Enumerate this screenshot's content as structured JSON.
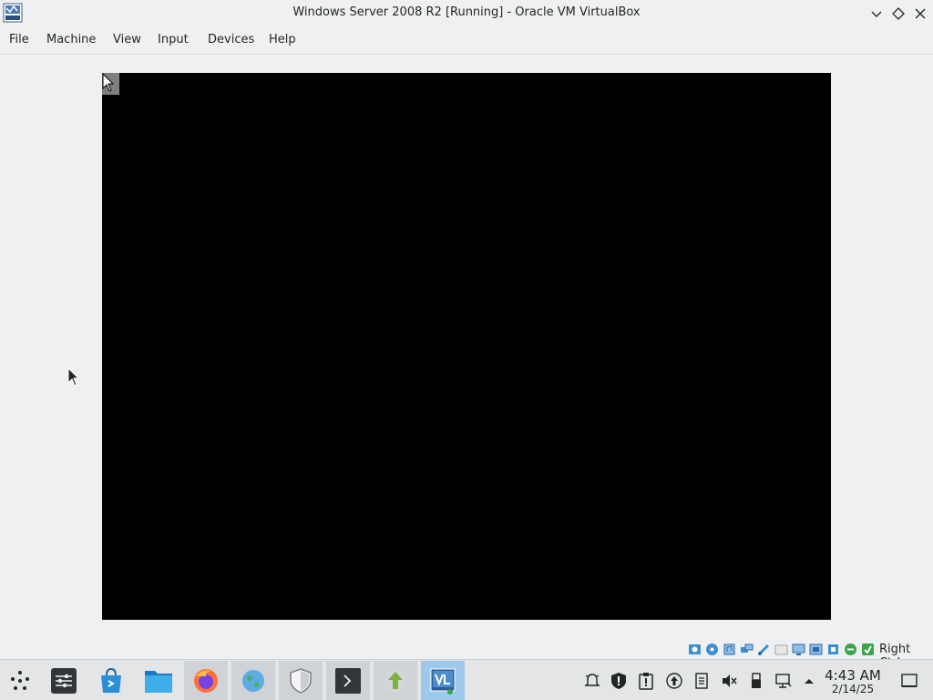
{
  "window": {
    "title": "Windows Server 2008 R2 [Running] - Oracle VM VirtualBox",
    "app_icon": "virtualbox-app-icon",
    "controls": [
      "minimize-icon",
      "maximize-icon",
      "close-icon"
    ]
  },
  "menubar": {
    "items": [
      "File",
      "Machine",
      "View",
      "Input",
      "Devices",
      "Help"
    ]
  },
  "vm_display": {
    "state": "Running",
    "background": "#000000"
  },
  "statusbar": {
    "icons": [
      "hard-disk-icon",
      "optical-drive-icon",
      "audio-icon",
      "network-icon",
      "usb-icon",
      "shared-folders-icon",
      "display-icon",
      "recording-icon",
      "cpu-icon",
      "mouse-integration-icon",
      "keyboard-icon"
    ],
    "host_key": "Right Ctrl"
  },
  "taskbar": {
    "launcher_icon": "application-launcher-icon",
    "apps": [
      {
        "name": "system-settings-icon"
      },
      {
        "name": "discover-store-icon"
      },
      {
        "name": "file-manager-icon"
      },
      {
        "name": "firefox-icon"
      },
      {
        "name": "web-browser-globe-icon"
      },
      {
        "name": "security-shield-icon"
      },
      {
        "name": "terminal-icon"
      },
      {
        "name": "update-manager-icon"
      },
      {
        "name": "virtualbox-icon"
      }
    ],
    "tray_icons": [
      "notifications-icon",
      "security-status-icon",
      "clipboard-icon",
      "updates-icon",
      "task-manager-icon",
      "volume-muted-icon",
      "usb-device-icon",
      "network-icon",
      "show-hidden-icons-chevron"
    ],
    "clock": {
      "time": "4:43 AM",
      "date": "2/14/25"
    },
    "show_desktop_icon": "show-desktop-icon"
  },
  "colors": {
    "background": "#eff0f1",
    "taskbar": "#e3e5e7",
    "active_task": "#9fc9eb",
    "vm_screen": "#000000"
  }
}
